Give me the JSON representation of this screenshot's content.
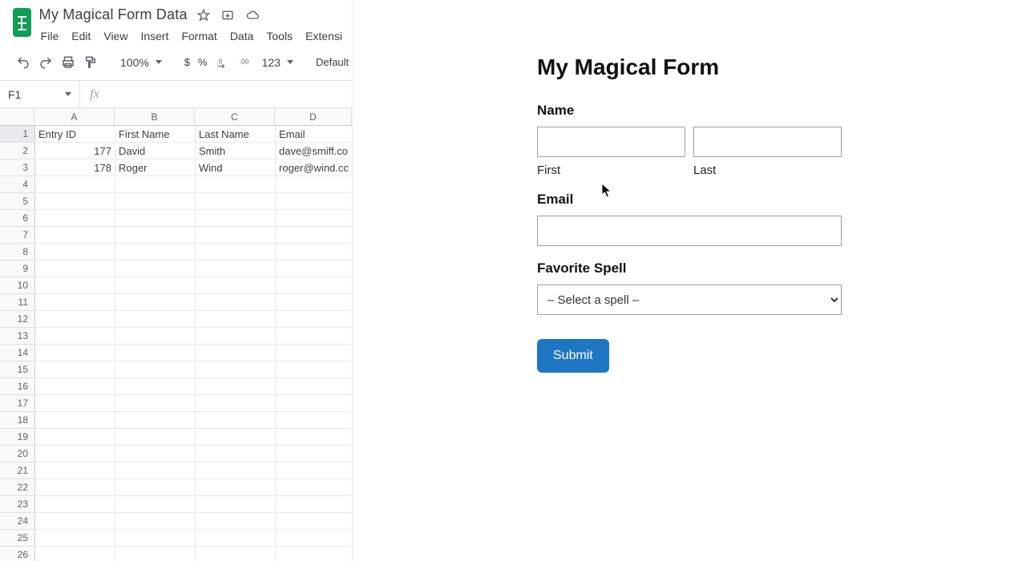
{
  "sheets": {
    "doc_title": "My Magical Form Data",
    "menus": [
      "File",
      "Edit",
      "View",
      "Insert",
      "Format",
      "Data",
      "Tools",
      "Extensi"
    ],
    "toolbar": {
      "zoom": "100%",
      "number_format": "123",
      "font": "Default"
    },
    "namebox": "F1",
    "fx_value": "",
    "columns": [
      "A",
      "B",
      "C",
      "D"
    ],
    "row_count": 26,
    "headers": [
      "Entry ID",
      "First Name",
      "Last Name",
      "Email"
    ],
    "rows": [
      {
        "id": "177",
        "first": "David",
        "last": "Smith",
        "email": "dave@smiff.co"
      },
      {
        "id": "178",
        "first": "Roger",
        "last": "Wind",
        "email": "roger@wind.cc"
      }
    ]
  },
  "form": {
    "title": "My Magical Form",
    "name_label": "Name",
    "first_sub": "First",
    "last_sub": "Last",
    "email_label": "Email",
    "spell_label": "Favorite Spell",
    "spell_placeholder": "– Select a spell –",
    "submit_label": "Submit"
  }
}
